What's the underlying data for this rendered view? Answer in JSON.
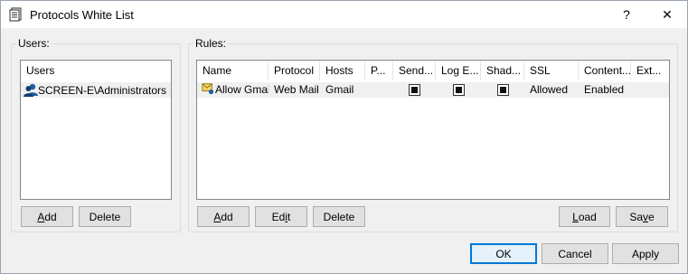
{
  "window": {
    "title": "Protocols White List",
    "help_glyph": "?",
    "close_glyph": "✕"
  },
  "users": {
    "group_label": "Users:",
    "column_header": "Users",
    "items": [
      {
        "label": "SCREEN-E\\Administrators"
      }
    ],
    "buttons": {
      "add": {
        "mnemonic": "A",
        "rest": "dd"
      },
      "delete": {
        "label": "Delete"
      }
    }
  },
  "rules": {
    "group_label": "Rules:",
    "columns": [
      "Name",
      "Protocol",
      "Hosts",
      "P...",
      "Send...",
      "Log E...",
      "Shad...",
      "SSL",
      "Content...",
      "Ext..."
    ],
    "rows": [
      {
        "name": "Allow Gmail",
        "protocol": "Web Mail",
        "hosts": "Gmail",
        "ssl": "Allowed",
        "content": "Enabled"
      }
    ],
    "buttons": {
      "add": {
        "mnemonic": "A",
        "rest": "dd"
      },
      "edit": {
        "pre": "Ed",
        "mnemonic": "i",
        "rest": "t"
      },
      "delete": {
        "label": "Delete"
      },
      "load": {
        "mnemonic": "L",
        "rest": "oad"
      },
      "save": {
        "pre": "Sa",
        "mnemonic": "v",
        "rest": "e"
      }
    }
  },
  "footer": {
    "ok": "OK",
    "cancel": "Cancel",
    "apply": "Apply"
  }
}
